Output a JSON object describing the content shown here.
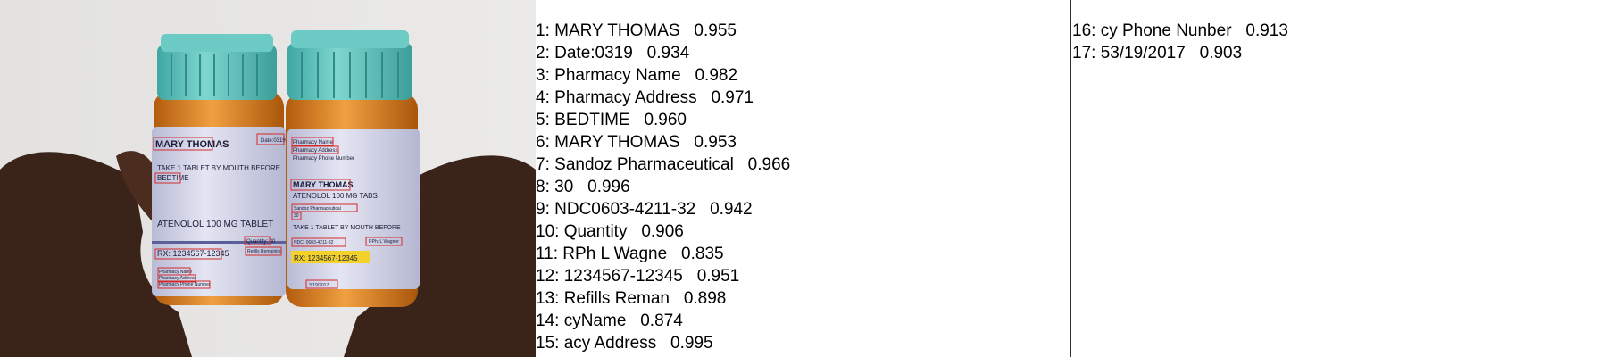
{
  "photo": {
    "left_label": {
      "patient": "MARY THOMAS",
      "date": "Date:0319",
      "instruction_1": "TAKE 1 TABLET BY MOUTH BEFORE",
      "instruction_2": "BEDTIME",
      "drug": "ATENOLOL 100 MG TABLET",
      "rx": "RX: 1234567-12345",
      "quantity": "Quantity: 30",
      "refills": "Refills Remaining",
      "pharmacy_name": "Pharmacy Name",
      "pharmacy_address": "Pharmacy Address",
      "pharmacy_phone": "Pharmacy Phone Number"
    },
    "right_label": {
      "pharmacy_name": "Pharmacy Name",
      "pharmacy_address": "Pharmacy Address",
      "pharmacy_phone": "Pharmacy Phone Number",
      "patient": "MARY THOMAS",
      "drug": "ATENOLOL 100 MG TABS",
      "maker": "Sandoz Pharmaceutical",
      "qty": "30",
      "instruction": "TAKE 1 TABLET BY MOUTH BEFORE",
      "ndc": "NDC: 0603-4211-32",
      "rph": "RPh: L Wagner",
      "rx": "RX: 1234567-12345",
      "date": "3/19/2017"
    }
  },
  "detections": [
    {
      "index": "1:",
      "text": "MARY THOMAS",
      "score": "0.955"
    },
    {
      "index": "2:",
      "text": "Date:0319",
      "score": "0.934"
    },
    {
      "index": "3:",
      "text": "Pharmacy Name",
      "score": "0.982"
    },
    {
      "index": "4:",
      "text": "Pharmacy Address",
      "score": "0.971"
    },
    {
      "index": "5:",
      "text": "BEDTIME",
      "score": "0.960"
    },
    {
      "index": "6:",
      "text": "MARY THOMAS",
      "score": "0.953"
    },
    {
      "index": "7:",
      "text": "Sandoz Pharmaceutical",
      "score": "0.966"
    },
    {
      "index": "8:",
      "text": "30",
      "score": "0.996"
    },
    {
      "index": "9:",
      "text": "NDC0603-4211-32",
      "score": "0.942"
    },
    {
      "index": "10:",
      "text": "Quantity",
      "score": "0.906"
    },
    {
      "index": "11:",
      "text": "RPh L Wagne",
      "score": "0.835"
    },
    {
      "index": "12:",
      "text": "1234567-12345",
      "score": "0.951"
    },
    {
      "index": "13:",
      "text": "Refills Reman",
      "score": "0.898"
    },
    {
      "index": "14:",
      "text": "cyName",
      "score": "0.874"
    },
    {
      "index": "15:",
      "text": "acy Address",
      "score": "0.995"
    },
    {
      "index": "16:",
      "text": "cy Phone Nunber",
      "score": "0.913"
    },
    {
      "index": "17:",
      "text": "53/19/2017",
      "score": "0.903"
    }
  ],
  "colors": {
    "box": "#d42a2a",
    "cap": "#5cc3bd",
    "bottle": "#d97f1c",
    "label": "#d6d8ec",
    "rx_highlight": "#f2d22a",
    "skin": "#3a2318"
  }
}
